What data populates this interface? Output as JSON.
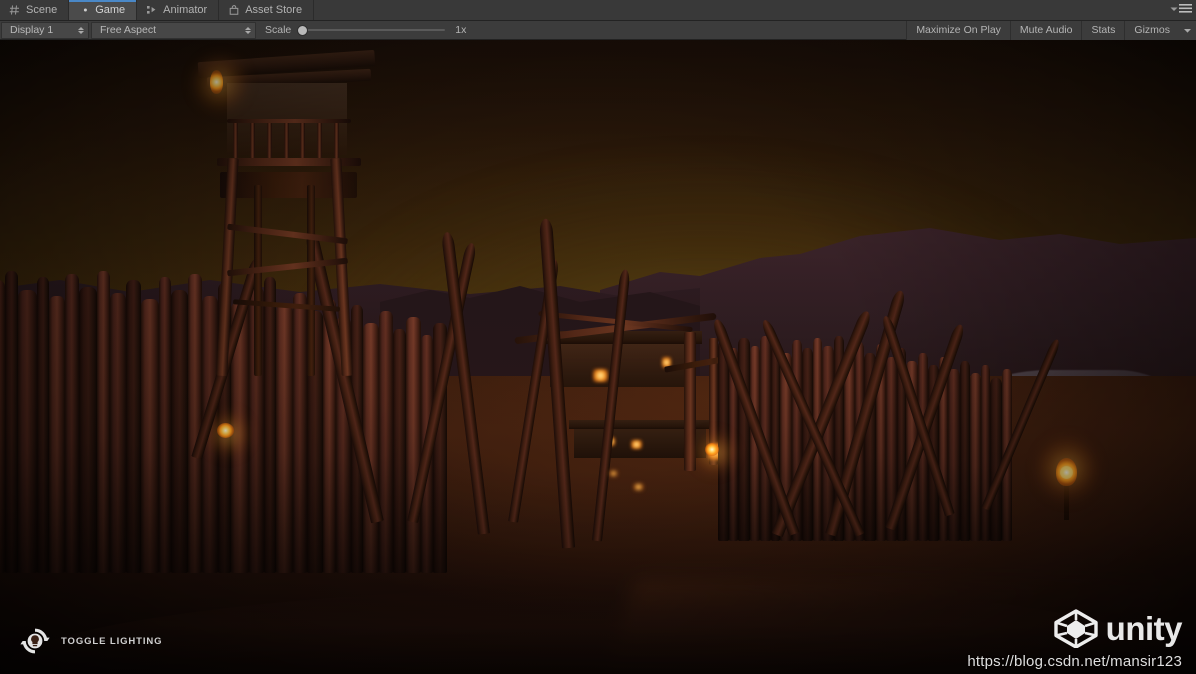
{
  "window": {
    "tabs": [
      {
        "label": "Scene",
        "icon": "grid-icon",
        "active": false
      },
      {
        "label": "Game",
        "icon": "gamepad-icon",
        "active": true
      },
      {
        "label": "Animator",
        "icon": "node-graph-icon",
        "active": false
      },
      {
        "label": "Asset Store",
        "icon": "shopping-bag-icon",
        "active": false
      }
    ],
    "options_menu_icon": "options-menu-icon"
  },
  "toolbar": {
    "display": {
      "label": "Display 1",
      "icon": "updown-arrows-icon"
    },
    "aspect": {
      "label": "Free Aspect",
      "icon": "updown-arrows-icon"
    },
    "scale": {
      "label": "Scale",
      "value": "1x",
      "position_pct": 0
    },
    "maximize_on_play": "Maximize On Play",
    "mute_audio": "Mute Audio",
    "stats": "Stats",
    "gizmos": "Gizmos",
    "gizmos_arrow_icon": "chevron-down-icon"
  },
  "hud": {
    "toggle_lighting": {
      "label": "TOGGLE LIGHTING",
      "icon": "lighting-refresh-icon"
    },
    "unity_logo": {
      "wordmark": "unity",
      "icon": "unity-cube-icon"
    },
    "watermark": "https://blog.csdn.net/mansir123"
  },
  "scene": {
    "description": "Night-time wooden fort with palisade walls, watchtower and torches",
    "colors": {
      "sky_top": "#170d07",
      "sky_horizon": "#4d3a0b",
      "ground": "#23120b",
      "wood": "#5b2b20",
      "torch_flame": "#ffd869",
      "cliff": "#6b6570"
    }
  },
  "theme": {
    "tab_active_accent": "#4a88c7",
    "tab_active_bg": "#4b4b4b",
    "chrome_bg": "#393939",
    "toolbar_bg": "#3c3c3c",
    "text": "#b4b4b4"
  }
}
